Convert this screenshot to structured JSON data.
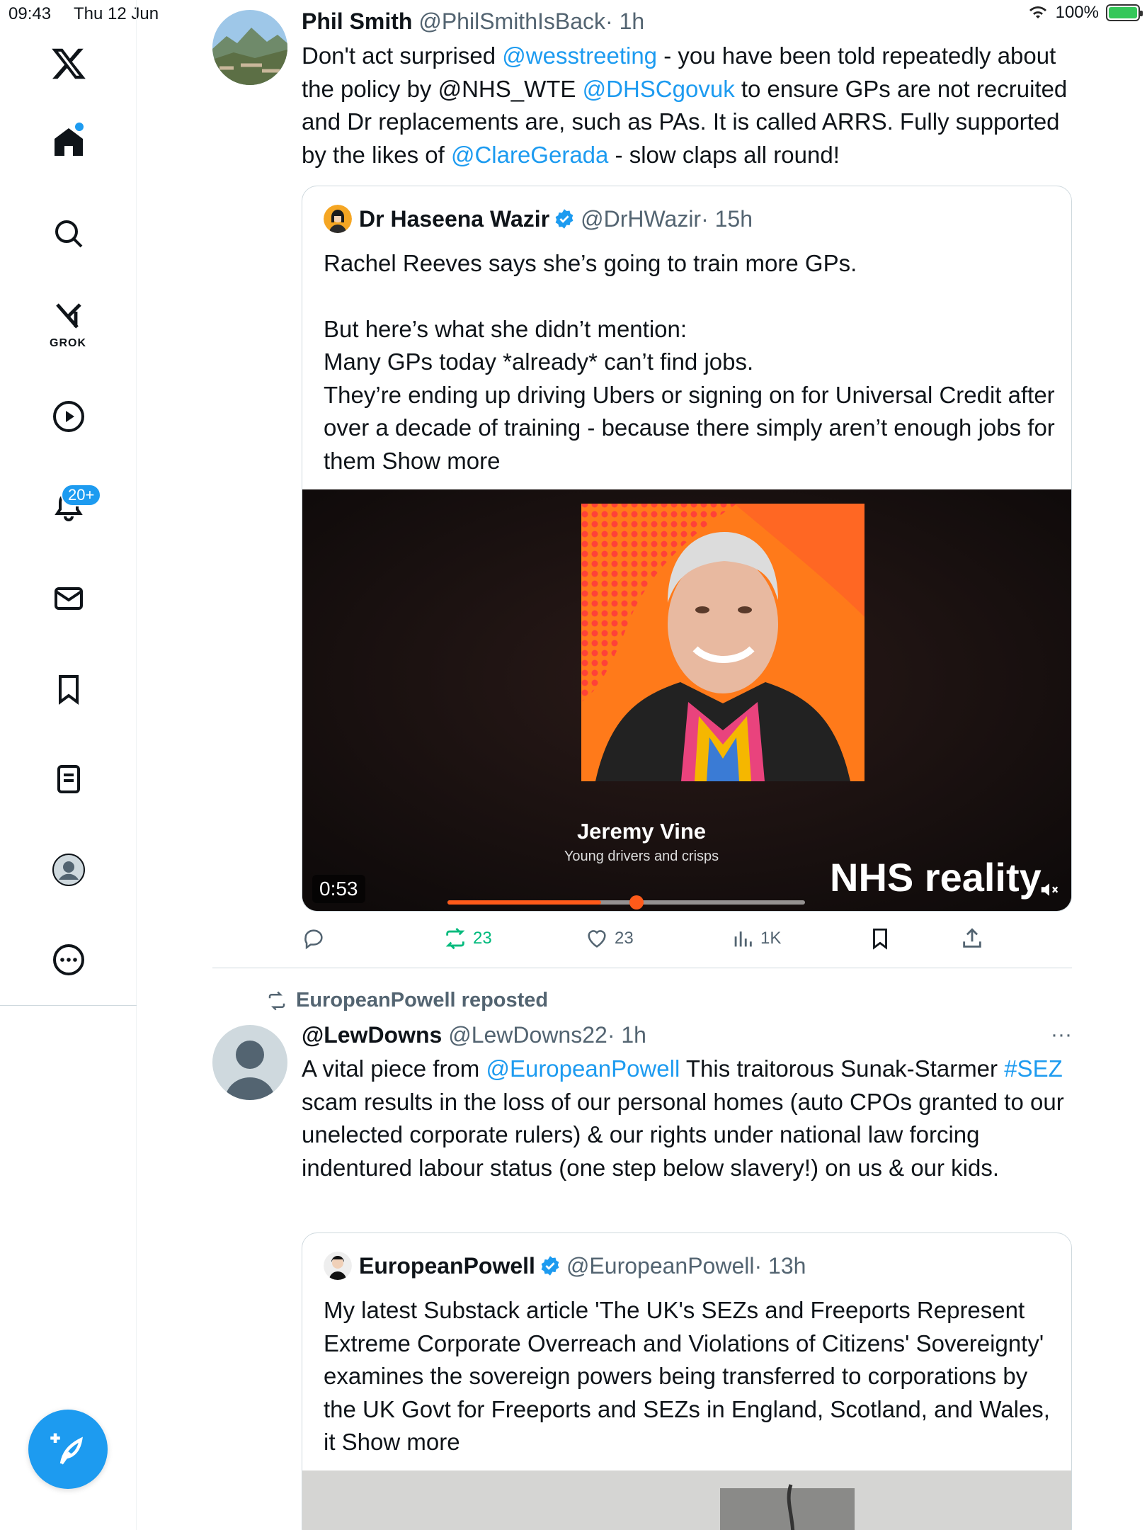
{
  "status_bar": {
    "time": "09:43",
    "date": "Thu 12 Jun",
    "battery": "100%"
  },
  "sidebar": {
    "notifications_badge": "20+",
    "grok_label": "GROK"
  },
  "tweet1": {
    "name": "Phil Smith",
    "handle": "@PhilSmithIsBack",
    "time": "· 1h",
    "body": [
      {
        "t": "Don't act surprised ",
        "link": false
      },
      {
        "t": "@wesstreeting",
        "link": true
      },
      {
        "t": " - you have been told repeatedly about the policy by @NHS_WTE ",
        "link": false
      },
      {
        "t": "@DHSCgovuk",
        "link": true
      },
      {
        "t": " to ensure GPs are not recruited and Dr replacements are, such as PAs. It is called ARRS. Fully supported by the likes of ",
        "link": false
      },
      {
        "t": "@ClareGerada",
        "link": true
      },
      {
        "t": " - slow claps all round!",
        "link": false
      }
    ],
    "quote": {
      "name": "Dr Haseena Wazir",
      "handle": "@DrHWazir",
      "time": "· 15h",
      "line1": "Rachel Reeves says she’s going to train more GPs.",
      "line2": "But here’s what she didn’t mention:",
      "line3": "Many GPs today *already* can’t find jobs.",
      "line4": "They’re ending up driving Ubers or signing on for Universal Credit after over a decade of training - because there simply aren’t enough jobs for them ",
      "show_more": "Show more",
      "video": {
        "caption_name": "Jeremy Vine",
        "caption_sub": "Young drivers and crisps",
        "overlay_text": "NHS reality",
        "duration": "0:53",
        "progress": 0.43
      }
    },
    "actions": {
      "retweets": "23",
      "likes": "23",
      "views": "1K"
    }
  },
  "tweet2": {
    "reposted_by": "EuropeanPowell reposted",
    "name": "@LewDowns",
    "handle": "@LewDowns22",
    "time": "· 1h",
    "more": "···",
    "body": [
      {
        "t": "A vital piece from ",
        "link": false
      },
      {
        "t": "@EuropeanPowell",
        "link": true
      },
      {
        "t": " This traitorous Sunak-Starmer ",
        "link": false
      },
      {
        "t": "#SEZ",
        "link": true
      },
      {
        "t": " scam results in the loss of our personal homes (auto CPOs granted to our unelected corporate rulers) & our rights under national law forcing indentured labour status (one step below slavery!) on us & our kids.",
        "link": false
      }
    ],
    "quote": {
      "name": "EuropeanPowell",
      "handle": "@EuropeanPowell",
      "time": "· 13h",
      "body": "My latest Substack article 'The UK's SEZs and Freeports Represent Extreme Corporate Overreach and Violations of Citizens' Sovereignty' examines the sovereign powers being transferred to corporations by the UK Govt for Freeports and SEZs in England, Scotland, and Wales, it ",
      "show_more": "Show more"
    }
  },
  "colors": {
    "accent": "#1d9bf0",
    "text": "#0f1419",
    "muted": "#536471",
    "retweet": "#00ba7c",
    "border": "#cfd9de"
  }
}
